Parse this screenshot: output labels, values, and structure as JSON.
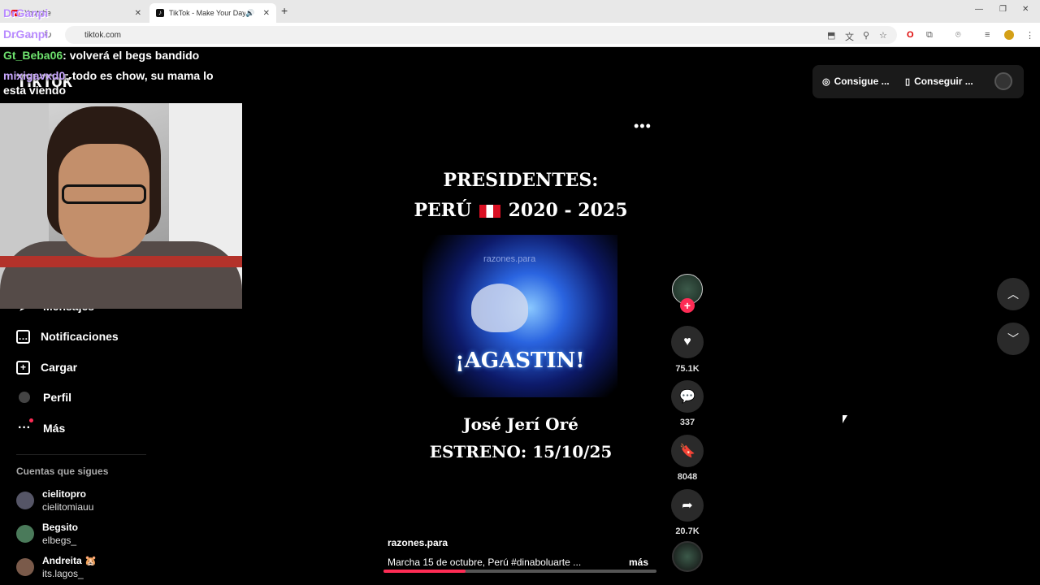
{
  "browser": {
    "tabs": [
      {
        "title": "Youtube",
        "active": false
      },
      {
        "title": "TikTok - Make Your Day",
        "active": true
      }
    ],
    "url": "tiktok.com"
  },
  "stream_overlay": {
    "streamer_name": "DrGanpi",
    "chat": [
      {
        "user": "Gt_Beba06",
        "message": ": volverá el begs bandido"
      },
      {
        "user": "mixigavxd0",
        "message": ": todo es chow, su mama lo esta viendo"
      }
    ]
  },
  "tiktok": {
    "logo": "TikTok",
    "sidebar": {
      "items": [
        {
          "label": "Mensajes",
          "icon": "paper-plane-icon"
        },
        {
          "label": "Notificaciones",
          "icon": "inbox-icon"
        },
        {
          "label": "Cargar",
          "icon": "plus-box-icon"
        },
        {
          "label": "Perfil",
          "icon": "avatar-icon"
        },
        {
          "label": "Más",
          "icon": "more-dots-icon"
        }
      ],
      "following_title": "Cuentas que sigues",
      "following": [
        {
          "name": "cielitopro",
          "handle": "cielitomiauu"
        },
        {
          "name": "Begsito",
          "handle": "elbegs_"
        },
        {
          "name": "Andreita 🐹",
          "handle": "its.lagos_"
        }
      ]
    },
    "top_right": {
      "btn1": "Consigue ...",
      "btn2": "Conseguir ..."
    },
    "video": {
      "line1": "PRESIDENTES:",
      "line2_a": "PERÚ",
      "line2_b": "2020 - 2025",
      "watermark": "razones.para",
      "image_text": "¡AGASTIN!",
      "line3": "José Jerí Oré",
      "line4": "ESTRENO: 15/10/25",
      "author": "razones.para",
      "caption": "Marcha 15 de octubre, Perú #dinaboluarte ...",
      "more": "más",
      "progress_fraction": 0.3
    },
    "actions": {
      "likes": "75.1K",
      "comments": "337",
      "saves": "8048",
      "shares": "20.7K"
    }
  },
  "colors": {
    "accent": "#fe2c55",
    "chat_user1": "#6ee36e",
    "chat_user2": "#c9a7ff"
  }
}
